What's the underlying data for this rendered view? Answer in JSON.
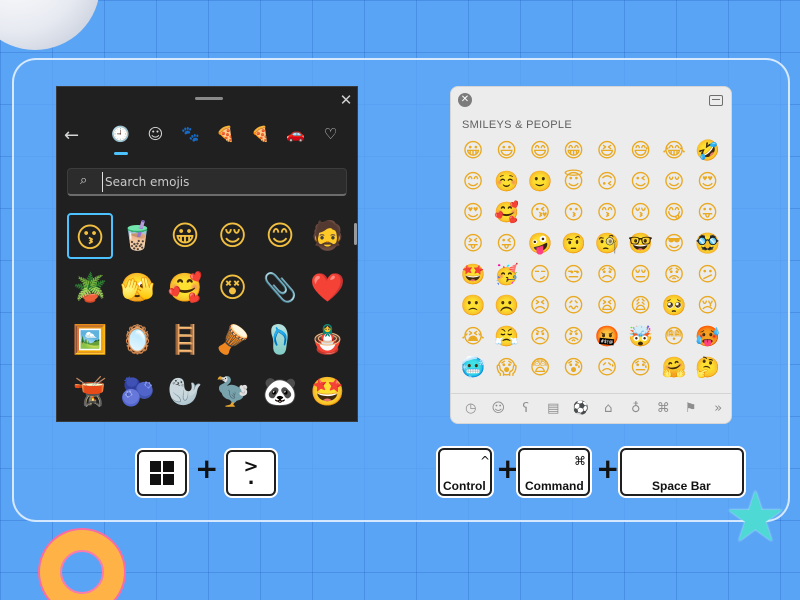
{
  "windows_picker": {
    "close_glyph": "✕",
    "back_glyph": "←",
    "search_placeholder": "Search emojis",
    "categories": [
      {
        "icon": "clock-icon",
        "glyph": "🕘"
      },
      {
        "icon": "smiley-icon",
        "glyph": "☺"
      },
      {
        "icon": "animal-icon",
        "glyph": "🐾"
      },
      {
        "icon": "food-icon",
        "glyph": "🍕"
      },
      {
        "icon": "pizza-icon",
        "glyph": "🍕"
      },
      {
        "icon": "car-icon",
        "glyph": "🚗"
      },
      {
        "icon": "heart-icon",
        "glyph": "♡"
      }
    ],
    "emojis": [
      [
        "😗",
        "🧋",
        "😀",
        "😌",
        "😊",
        "🧔"
      ],
      [
        "🪴",
        "🫣",
        "🥰",
        "😵",
        "📎",
        "❤️"
      ],
      [
        "🖼️",
        "🪞",
        "🪜",
        "🪘",
        "🩴",
        "🪆"
      ],
      [
        "🫕",
        "🫐",
        "🦭",
        "🦤",
        "🐼",
        "🤩"
      ]
    ]
  },
  "mac_picker": {
    "close_glyph": "✕",
    "section_title": "SMILEYS & PEOPLE",
    "emojis": [
      [
        "😀",
        "😃",
        "😄",
        "😁",
        "😆",
        "😅",
        "😂",
        "🤣"
      ],
      [
        "😊",
        "☺️",
        "🙂",
        "😇",
        "🙃",
        "😉",
        "😌",
        "😍"
      ],
      [
        "😍",
        "🥰",
        "😘",
        "😗",
        "😙",
        "😚",
        "😋",
        "😛"
      ],
      [
        "😝",
        "😜",
        "🤪",
        "🤨",
        "🧐",
        "🤓",
        "😎",
        "🥸"
      ],
      [
        "🤩",
        "🥳",
        "😏",
        "😒",
        "😞",
        "😔",
        "😟",
        "😕"
      ],
      [
        "🙁",
        "☹️",
        "😣",
        "😖",
        "😫",
        "😩",
        "🥺",
        "😢"
      ],
      [
        "😭",
        "😤",
        "😠",
        "😡",
        "🤬",
        "🤯",
        "😳",
        "🥵"
      ],
      [
        "🥶",
        "😱",
        "😨",
        "😰",
        "😥",
        "😓",
        "🤗",
        "🤔"
      ]
    ],
    "bottom_tabs": [
      {
        "icon": "clock-icon",
        "glyph": "◷"
      },
      {
        "icon": "smiley-icon",
        "glyph": "☺"
      },
      {
        "icon": "bear-icon",
        "glyph": "ʕ"
      },
      {
        "icon": "food-icon",
        "glyph": "▤"
      },
      {
        "icon": "ball-icon",
        "glyph": "⚽"
      },
      {
        "icon": "building-icon",
        "glyph": "⌂"
      },
      {
        "icon": "bulb-icon",
        "glyph": "♁"
      },
      {
        "icon": "symbols-icon",
        "glyph": "⌘"
      },
      {
        "icon": "flag-icon",
        "glyph": "⚑"
      },
      {
        "icon": "more-icon",
        "glyph": "»"
      }
    ]
  },
  "shortcuts": {
    "plus": "+",
    "windows": {
      "dot_key_top": ">",
      "dot_key_bottom": "."
    },
    "mac": {
      "control_label": "Control",
      "control_symbol": "^",
      "command_label": "Command",
      "command_symbol": "⌘",
      "space_label": "Space Bar"
    }
  }
}
